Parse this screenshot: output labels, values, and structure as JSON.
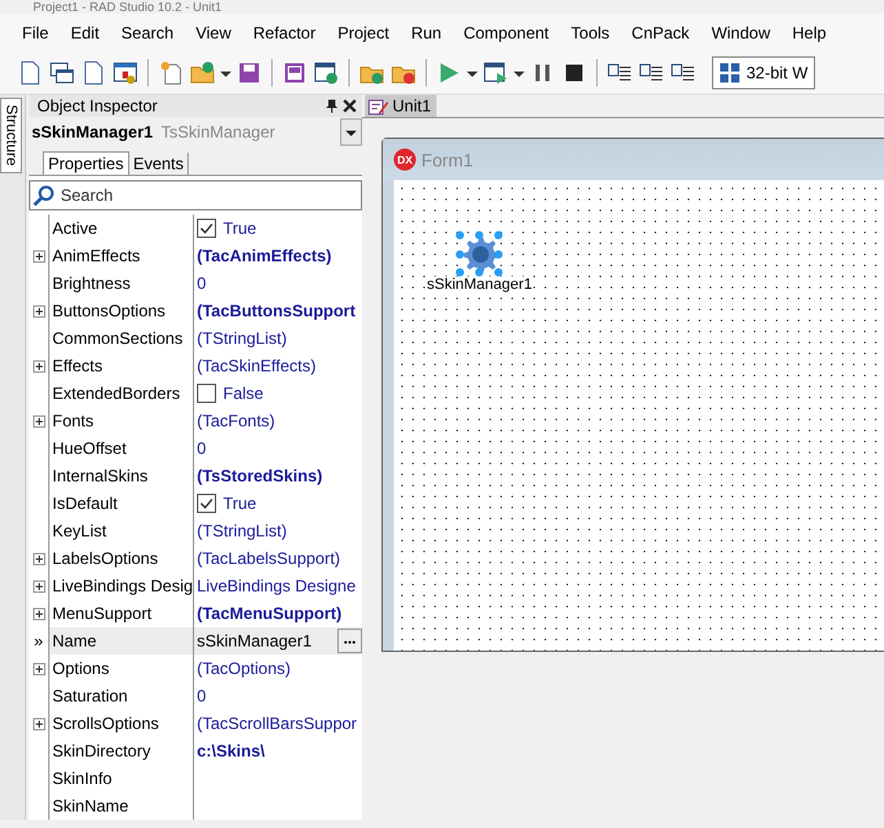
{
  "window": {
    "title": "Project1 - RAD Studio 10.2 - Unit1"
  },
  "menu": [
    "File",
    "Edit",
    "Search",
    "View",
    "Refactor",
    "Project",
    "Run",
    "Component",
    "Tools",
    "CnPack",
    "Window",
    "Help"
  ],
  "toolbar": {
    "platform": "32-bit W"
  },
  "side_tab": {
    "label": "Structure"
  },
  "inspector": {
    "title": "Object Inspector",
    "component_name": "sSkinManager1",
    "component_type": "TsSkinManager",
    "tabs": [
      {
        "label": "Properties",
        "selected": true
      },
      {
        "label": "Events",
        "selected": false
      }
    ],
    "search": {
      "placeholder": "Search"
    },
    "current_marker": "»",
    "properties": [
      {
        "name": "Active",
        "value": "True",
        "kind": "checkbox",
        "checked": true,
        "expandable": false,
        "modified": false,
        "selected": false
      },
      {
        "name": "AnimEffects",
        "value": "(TacAnimEffects)",
        "kind": "text",
        "expandable": true,
        "modified": true,
        "selected": false
      },
      {
        "name": "Brightness",
        "value": "0",
        "kind": "text",
        "expandable": false,
        "modified": false,
        "selected": false
      },
      {
        "name": "ButtonsOptions",
        "value": "(TacButtonsSupport",
        "kind": "text",
        "expandable": true,
        "modified": true,
        "selected": false
      },
      {
        "name": "CommonSections",
        "value": "(TStringList)",
        "kind": "text",
        "expandable": false,
        "modified": false,
        "selected": false
      },
      {
        "name": "Effects",
        "value": "(TacSkinEffects)",
        "kind": "text",
        "expandable": true,
        "modified": false,
        "selected": false
      },
      {
        "name": "ExtendedBorders",
        "value": "False",
        "kind": "checkbox",
        "checked": false,
        "expandable": false,
        "modified": false,
        "selected": false
      },
      {
        "name": "Fonts",
        "value": "(TacFonts)",
        "kind": "text",
        "expandable": true,
        "modified": false,
        "selected": false
      },
      {
        "name": "HueOffset",
        "value": "0",
        "kind": "text",
        "expandable": false,
        "modified": false,
        "selected": false
      },
      {
        "name": "InternalSkins",
        "value": "(TsStoredSkins)",
        "kind": "text",
        "expandable": false,
        "modified": true,
        "selected": false
      },
      {
        "name": "IsDefault",
        "value": "True",
        "kind": "checkbox",
        "checked": true,
        "expandable": false,
        "modified": false,
        "selected": false
      },
      {
        "name": "KeyList",
        "value": "(TStringList)",
        "kind": "text",
        "expandable": false,
        "modified": false,
        "selected": false
      },
      {
        "name": "LabelsOptions",
        "value": "(TacLabelsSupport)",
        "kind": "text",
        "expandable": true,
        "modified": false,
        "selected": false
      },
      {
        "name": "LiveBindings Desig",
        "value": "LiveBindings Designe",
        "kind": "text",
        "expandable": true,
        "modified": false,
        "selected": false
      },
      {
        "name": "MenuSupport",
        "value": "(TacMenuSupport)",
        "kind": "text",
        "expandable": true,
        "modified": true,
        "selected": false
      },
      {
        "name": "Name",
        "value": "sSkinManager1",
        "kind": "edit",
        "expandable": false,
        "modified": false,
        "selected": true
      },
      {
        "name": "Options",
        "value": "(TacOptions)",
        "kind": "text",
        "expandable": true,
        "modified": false,
        "selected": false
      },
      {
        "name": "Saturation",
        "value": "0",
        "kind": "text",
        "expandable": false,
        "modified": false,
        "selected": false
      },
      {
        "name": "ScrollsOptions",
        "value": "(TacScrollBarsSuppor",
        "kind": "text",
        "expandable": true,
        "modified": false,
        "selected": false
      },
      {
        "name": "SkinDirectory",
        "value": "c:\\Skins\\",
        "kind": "text",
        "expandable": false,
        "modified": true,
        "selected": false
      },
      {
        "name": "SkinInfo",
        "kind": "text",
        "expandable": false,
        "selected": false
      },
      {
        "name": "SkinName",
        "kind": "text",
        "expandable": false,
        "selected": false
      }
    ]
  },
  "editor_tabs": [
    {
      "label": "Unit1",
      "selected": true
    }
  ],
  "form": {
    "caption": "Form1",
    "badge": "DX",
    "component": {
      "label": "sSkinManager1",
      "selected": true
    }
  }
}
